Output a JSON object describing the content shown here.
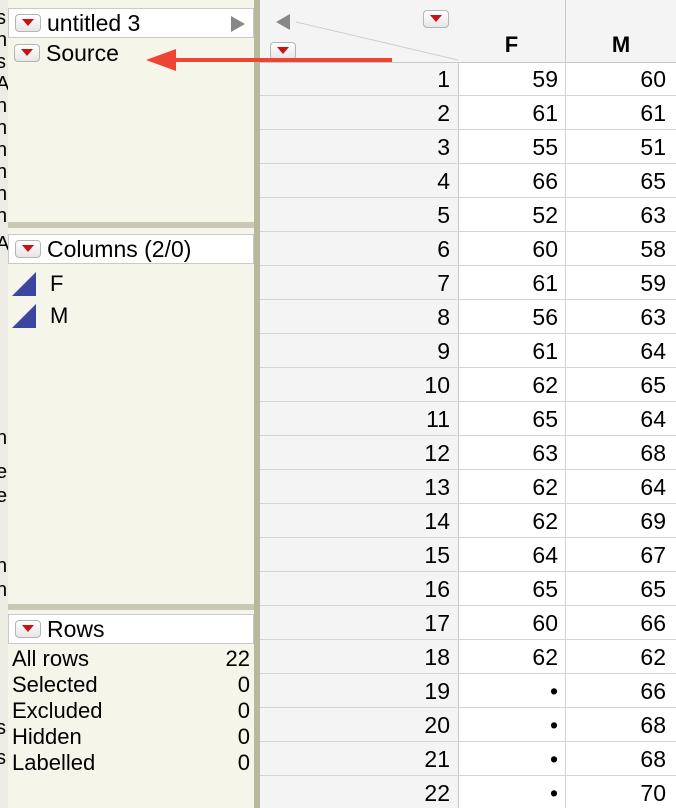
{
  "left_panel": {
    "table_name": "untitled 3",
    "source_label": "Source",
    "columns_header": "Columns (2/0)",
    "columns": [
      {
        "name": "F",
        "icon": "continuous-column-icon"
      },
      {
        "name": "M",
        "icon": "continuous-column-icon"
      }
    ],
    "rows_header": "Rows",
    "row_states": [
      {
        "label": "All rows",
        "value": "22"
      },
      {
        "label": "Selected",
        "value": "0"
      },
      {
        "label": "Excluded",
        "value": "0"
      },
      {
        "label": "Hidden",
        "value": "0"
      },
      {
        "label": "Labelled",
        "value": "0"
      }
    ]
  },
  "grid": {
    "column_headers": [
      "F",
      "M"
    ],
    "rows": [
      {
        "n": "1",
        "F": "59",
        "M": "60"
      },
      {
        "n": "2",
        "F": "61",
        "M": "61"
      },
      {
        "n": "3",
        "F": "55",
        "M": "51"
      },
      {
        "n": "4",
        "F": "66",
        "M": "65"
      },
      {
        "n": "5",
        "F": "52",
        "M": "63"
      },
      {
        "n": "6",
        "F": "60",
        "M": "58"
      },
      {
        "n": "7",
        "F": "61",
        "M": "59"
      },
      {
        "n": "8",
        "F": "56",
        "M": "63"
      },
      {
        "n": "9",
        "F": "61",
        "M": "64"
      },
      {
        "n": "10",
        "F": "62",
        "M": "65"
      },
      {
        "n": "11",
        "F": "65",
        "M": "64"
      },
      {
        "n": "12",
        "F": "63",
        "M": "68"
      },
      {
        "n": "13",
        "F": "62",
        "M": "64"
      },
      {
        "n": "14",
        "F": "62",
        "M": "69"
      },
      {
        "n": "15",
        "F": "64",
        "M": "67"
      },
      {
        "n": "16",
        "F": "65",
        "M": "65"
      },
      {
        "n": "17",
        "F": "60",
        "M": "66"
      },
      {
        "n": "18",
        "F": "62",
        "M": "62"
      },
      {
        "n": "19",
        "F": "•",
        "M": "66"
      },
      {
        "n": "20",
        "F": "•",
        "M": "68"
      },
      {
        "n": "21",
        "F": "•",
        "M": "68"
      },
      {
        "n": "22",
        "F": "•",
        "M": "70"
      }
    ]
  },
  "colors": {
    "hotspot_red": "#cc1111",
    "annotation_arrow": "#ee4433",
    "column_icon": "#3c46a0"
  }
}
